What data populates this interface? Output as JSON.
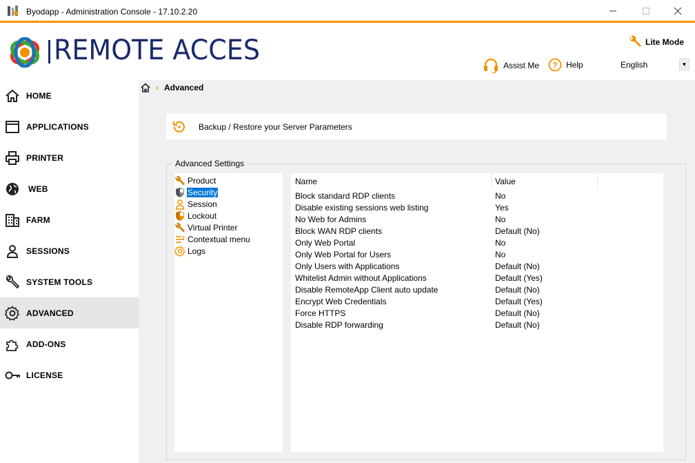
{
  "window": {
    "title": "Byodapp - Administration Console - 17.10.2.20",
    "accent": "#f39200"
  },
  "header": {
    "brand": "REMOTE ACCES",
    "lite_mode": "Lite Mode",
    "assist": "Assist Me",
    "help": "Help",
    "language": "English"
  },
  "sidebar": {
    "items": [
      {
        "label": "HOME",
        "icon": "home-icon"
      },
      {
        "label": "APPLICATIONS",
        "icon": "window-icon"
      },
      {
        "label": "PRINTER",
        "icon": "printer-icon"
      },
      {
        "label": "WEB",
        "icon": "globe-icon"
      },
      {
        "label": "FARM",
        "icon": "building-icon"
      },
      {
        "label": "SESSIONS",
        "icon": "user-icon"
      },
      {
        "label": "SYSTEM TOOLS",
        "icon": "wrench-icon"
      },
      {
        "label": "ADVANCED",
        "icon": "gear-icon",
        "active": true
      },
      {
        "label": "ADD-ONS",
        "icon": "puzzle-icon"
      },
      {
        "label": "LICENSE",
        "icon": "key-icon"
      }
    ]
  },
  "breadcrumb": {
    "current": "Advanced"
  },
  "backup": {
    "label": "Backup / Restore your Server Parameters"
  },
  "settings": {
    "legend": "Advanced Settings",
    "tree": [
      {
        "label": "Product",
        "icon": "wrench-icon"
      },
      {
        "label": "Security",
        "icon": "shield-icon",
        "selected": true
      },
      {
        "label": "Session",
        "icon": "user-icon"
      },
      {
        "label": "Lockout",
        "icon": "shield-icon"
      },
      {
        "label": "Virtual Printer",
        "icon": "wrench-icon"
      },
      {
        "label": "Contextual menu",
        "icon": "menu-icon"
      },
      {
        "label": "Logs",
        "icon": "gear-icon"
      }
    ],
    "columns": {
      "name": "Name",
      "value": "Value"
    },
    "rows": [
      {
        "name": "Block standard RDP clients",
        "value": "No"
      },
      {
        "name": "Disable existing sessions web listing",
        "value": "Yes"
      },
      {
        "name": "No Web for Admins",
        "value": "No"
      },
      {
        "name": "Block WAN RDP clients",
        "value": "Default (No)"
      },
      {
        "name": "Only Web Portal",
        "value": "No"
      },
      {
        "name": "Only Web Portal for Users",
        "value": "No"
      },
      {
        "name": "Only Users with Applications",
        "value": "Default (No)"
      },
      {
        "name": "Whitelist Admin without Applications",
        "value": "Default (Yes)"
      },
      {
        "name": "Disable RemoteApp Client auto update",
        "value": "Default (No)"
      },
      {
        "name": "Encrypt Web Credentials",
        "value": "Default (Yes)"
      },
      {
        "name": "Force HTTPS",
        "value": "Default (No)"
      },
      {
        "name": "Disable RDP forwarding",
        "value": "Default (No)"
      }
    ]
  }
}
